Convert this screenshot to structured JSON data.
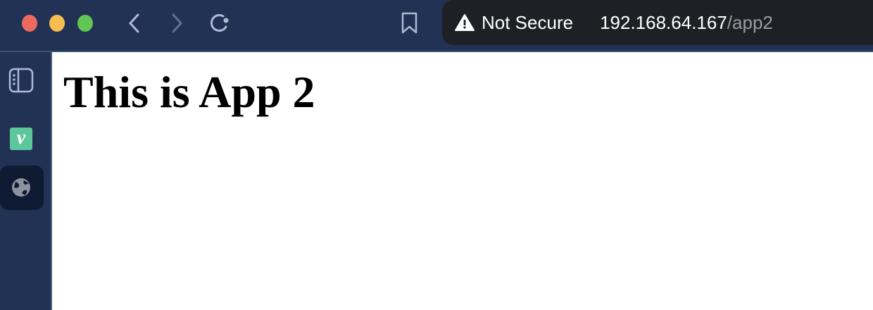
{
  "window": {
    "colors": {
      "close": "#ee6a5f",
      "minimize": "#f5be4f",
      "maximize": "#62c554"
    }
  },
  "address_bar": {
    "security_label": "Not Secure",
    "host": "192.168.64.167",
    "path": "/app2"
  },
  "sidebar": {
    "items": [
      {
        "icon": "sidebar-toggle-icon"
      },
      {
        "icon": "vimeo-icon",
        "label": "v"
      },
      {
        "icon": "globe-icon"
      }
    ]
  },
  "page": {
    "heading": "This is App 2"
  }
}
